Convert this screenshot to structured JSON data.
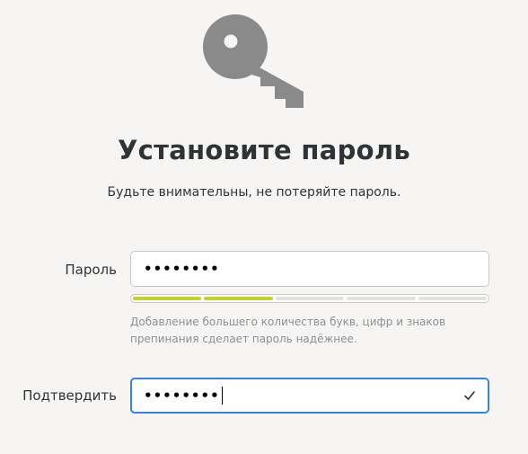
{
  "header": {
    "title": "Установите пароль",
    "subtitle": "Будьте внимательны, не потеряйте пароль."
  },
  "icons": {
    "hero": "key-icon",
    "confirm_status": "checkmark-icon"
  },
  "password": {
    "label": "Пароль",
    "masked_value": "••••••••",
    "strength_level": 2,
    "strength_segments": 5,
    "hint": "Добавление большего количества букв, цифр и знаков препинания сделает пароль надёжнее."
  },
  "confirm": {
    "label": "Подтвердить",
    "masked_value": "••••••••",
    "matches": true
  },
  "colors": {
    "accent": "#3584e4",
    "strength_fill": "#c8ce2c",
    "icon_gray": "#8a8a8a",
    "background": "#f6f5f4"
  }
}
